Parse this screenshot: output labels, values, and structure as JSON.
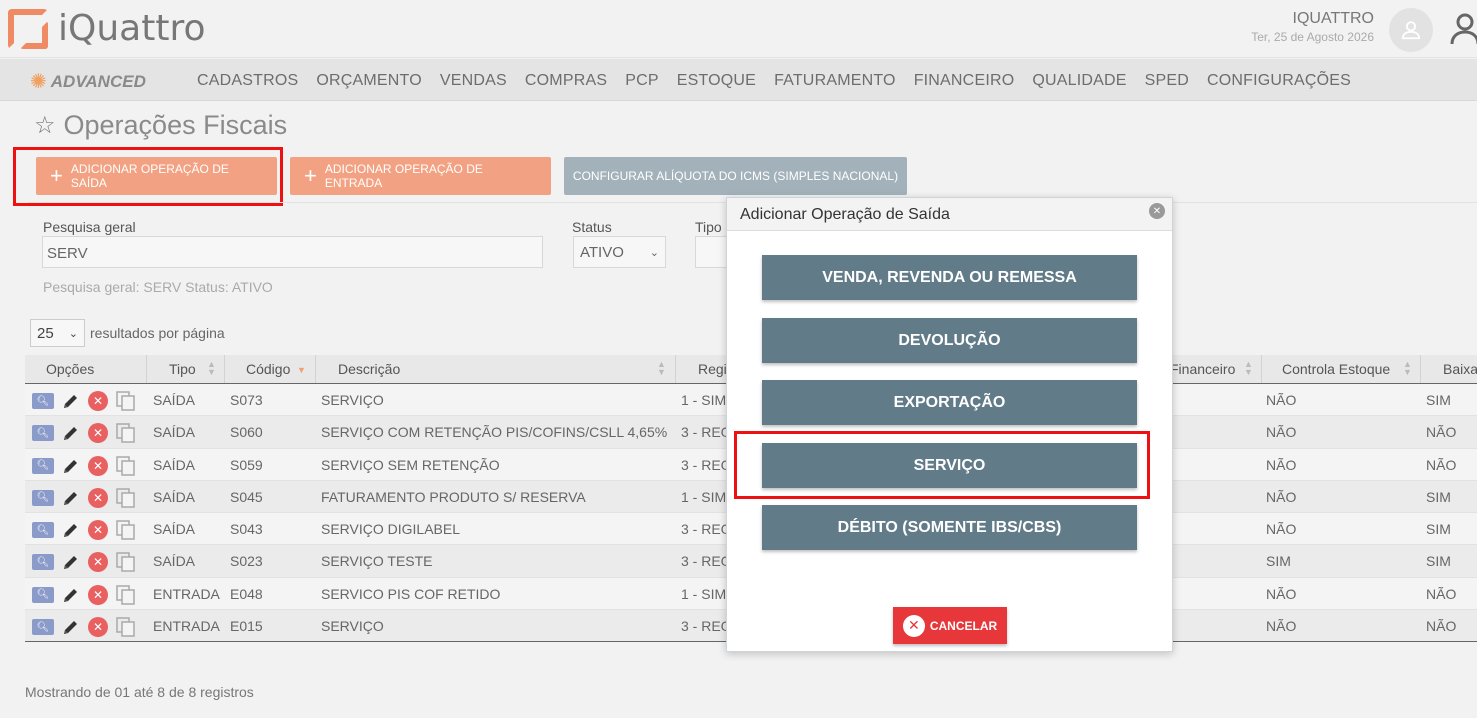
{
  "header": {
    "logo_text": "iQuattro",
    "user_name": "IQUATTRO",
    "date": "Ter, 25 de Agosto 2026"
  },
  "nav": {
    "brand": "ADVANCED",
    "items": [
      "CADASTROS",
      "ORÇAMENTO",
      "VENDAS",
      "COMPRAS",
      "PCP",
      "ESTOQUE",
      "FATURAMENTO",
      "FINANCEIRO",
      "QUALIDADE",
      "SPED",
      "CONFIGURAÇÕES"
    ]
  },
  "page": {
    "title": "Operações Fiscais",
    "btn_add_saida": "ADICIONAR OPERAÇÃO DE SAÍDA",
    "btn_add_entrada": "ADICIONAR OPERAÇÃO DE ENTRADA",
    "btn_config_icms": "CONFIGURAR ALÍQUOTA DO ICMS (SIMPLES NACIONAL)"
  },
  "filters": {
    "search_label": "Pesquisa geral",
    "search_value": "SERV",
    "status_label": "Status",
    "status_value": "ATIVO",
    "tipo_label": "Tipo",
    "summary": "Pesquisa geral: SERV   Status: ATIVO",
    "per_page_value": "25",
    "per_page_label": "resultados por página"
  },
  "table": {
    "headers": [
      "Opções",
      "Tipo",
      "Código",
      "Descrição",
      "Regi",
      "Financeiro",
      "Controla Estoque",
      "Baixa"
    ],
    "rows": [
      {
        "tipo": "SAÍDA",
        "codigo": "S073",
        "descricao": "SERVIÇO",
        "regime": "1 - SIM",
        "estoque": "NÃO",
        "baixa": "SIM"
      },
      {
        "tipo": "SAÍDA",
        "codigo": "S060",
        "descricao": "SERVIÇO COM RETENÇÃO PIS/COFINS/CSLL 4,65%",
        "regime": "3 - REG",
        "estoque": "NÃO",
        "baixa": "NÃO"
      },
      {
        "tipo": "SAÍDA",
        "codigo": "S059",
        "descricao": "SERVIÇO SEM RETENÇÃO",
        "regime": "3 - REG",
        "estoque": "NÃO",
        "baixa": "NÃO"
      },
      {
        "tipo": "SAÍDA",
        "codigo": "S045",
        "descricao": "FATURAMENTO PRODUTO S/ RESERVA",
        "regime": "1 - SIM",
        "estoque": "NÃO",
        "baixa": "SIM"
      },
      {
        "tipo": "SAÍDA",
        "codigo": "S043",
        "descricao": "SERVIÇO DIGILABEL",
        "regime": "3 - REG",
        "estoque": "NÃO",
        "baixa": "SIM"
      },
      {
        "tipo": "SAÍDA",
        "codigo": "S023",
        "descricao": "SERVIÇO TESTE",
        "regime": "3 - REG",
        "estoque": "SIM",
        "baixa": "SIM"
      },
      {
        "tipo": "ENTRADA",
        "codigo": "E048",
        "descricao": "SERVICO PIS COF RETIDO",
        "regime": "1 - SIM",
        "estoque": "NÃO",
        "baixa": "NÃO"
      },
      {
        "tipo": "ENTRADA",
        "codigo": "E015",
        "descricao": "SERVIÇO",
        "regime": "3 - REG",
        "estoque": "NÃO",
        "baixa": "NÃO"
      }
    ],
    "footer": "Mostrando de 01 até 8 de 8 registros"
  },
  "modal": {
    "title": "Adicionar Operação de Saída",
    "options": [
      "VENDA, REVENDA OU REMESSA",
      "DEVOLUÇÃO",
      "EXPORTAÇÃO",
      "SERVIÇO",
      "DÉBITO (SOMENTE IBS/CBS)"
    ],
    "cancel": "CANCELAR"
  },
  "colors": {
    "accent_orange": "#f2a283",
    "modal_button": "#627b89",
    "highlight": "#ee1111",
    "cancel": "#e8373a"
  }
}
